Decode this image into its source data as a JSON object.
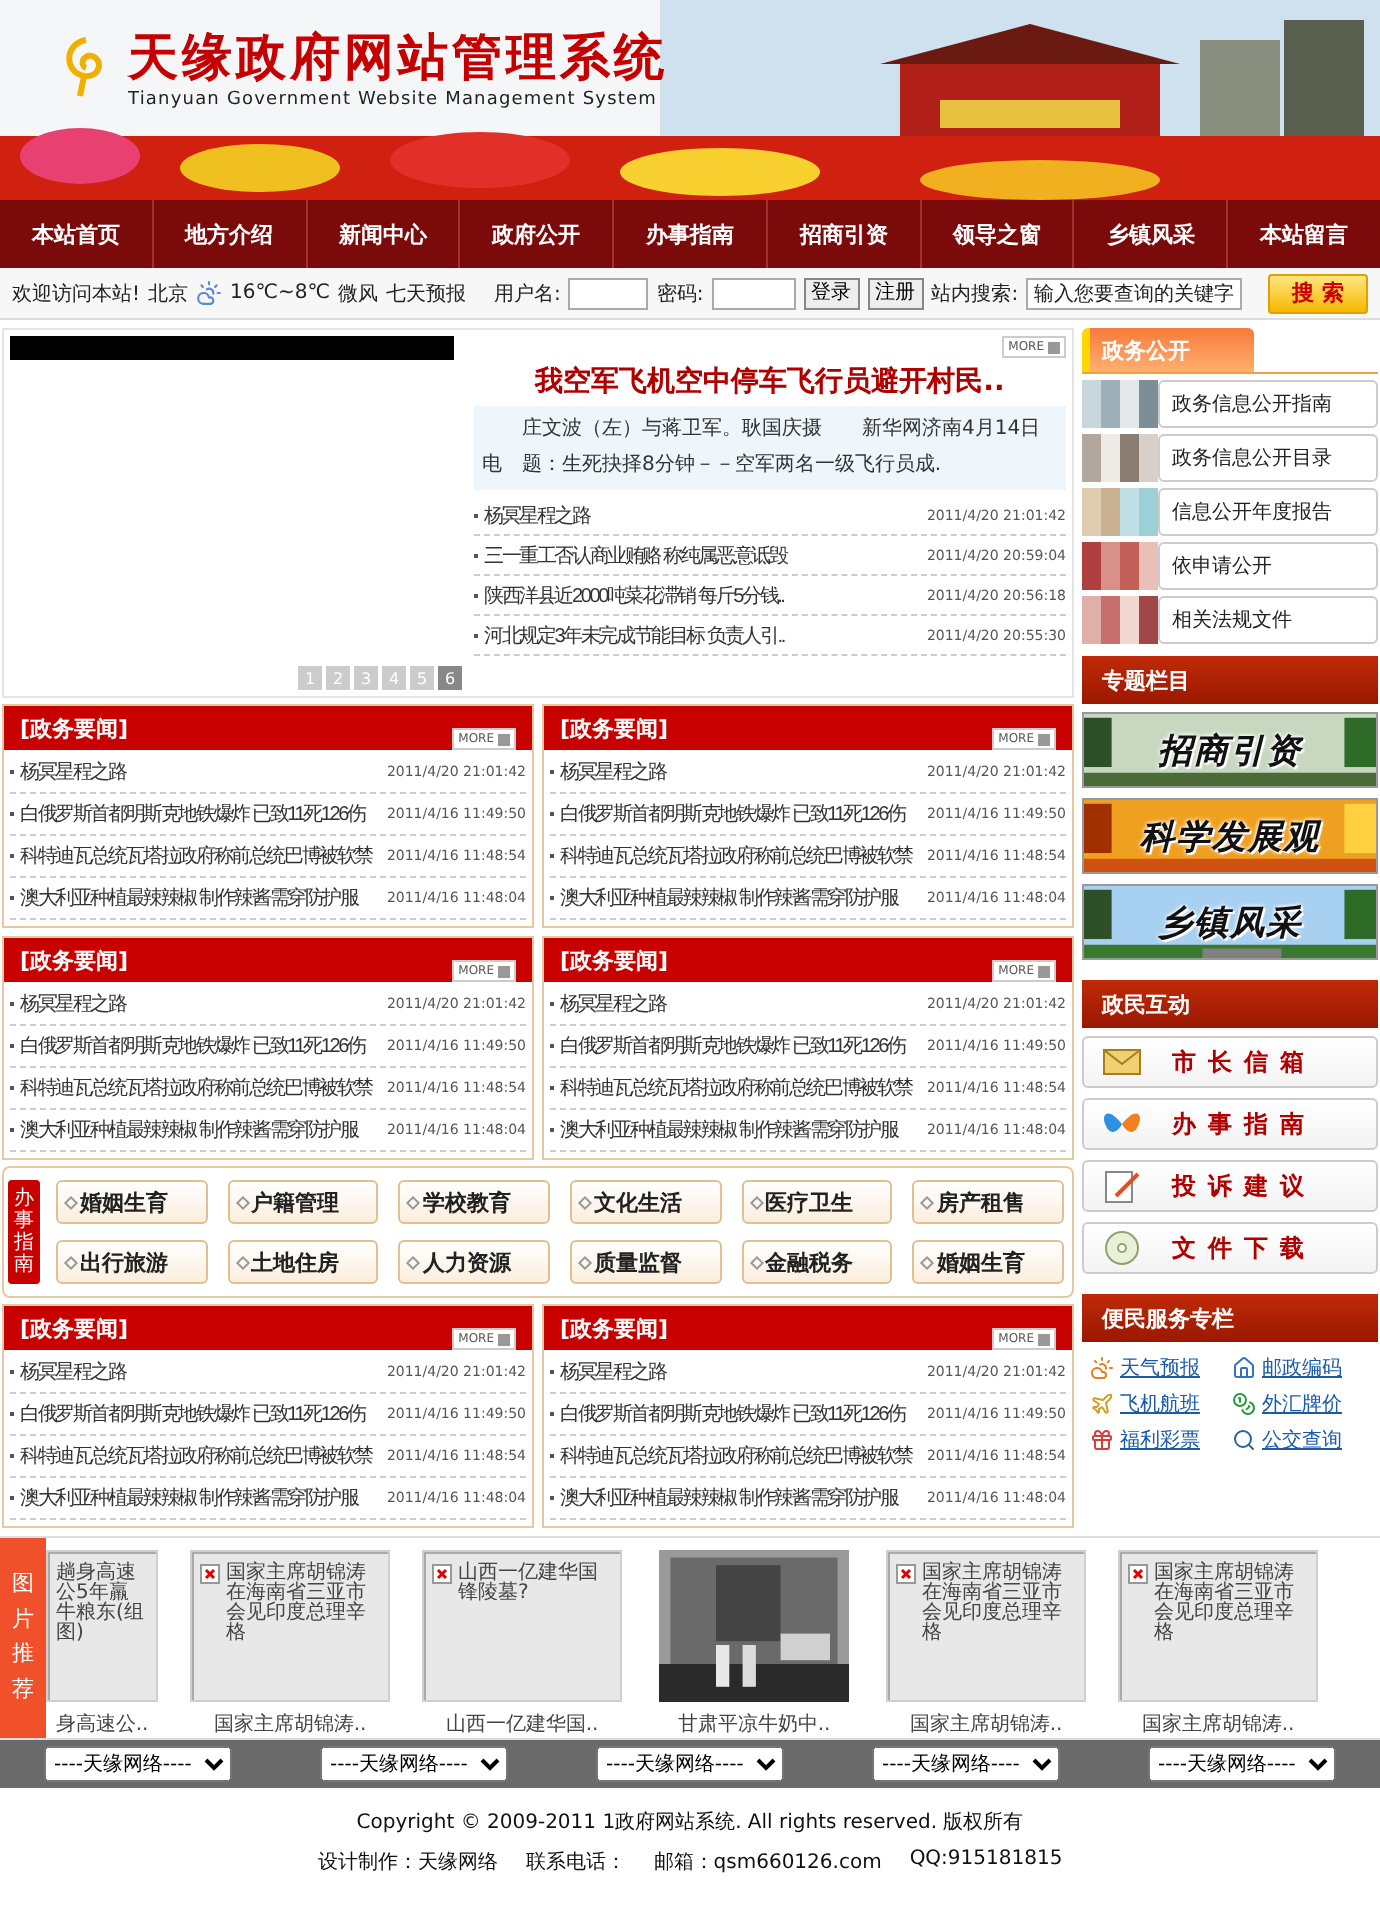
{
  "header": {
    "title": "天缘政府网站管理系统",
    "subtitle": "Tianyuan Government Website Management System"
  },
  "nav": [
    "本站首页",
    "地方介绍",
    "新闻中心",
    "政府公开",
    "办事指南",
    "招商引资",
    "领导之窗",
    "乡镇风采",
    "本站留言"
  ],
  "infobar": {
    "welcome": "欢迎访问本站!",
    "city": "北京",
    "temperature": "16℃~8℃",
    "wind": "微风",
    "forecast": "七天预报",
    "username_label": "用户名:",
    "password_label": "密码:",
    "login": "登录",
    "register": "注册",
    "search_label": "站内搜索:",
    "search_value": "输入您要查询的关键字",
    "search_button": "搜 索"
  },
  "slideshow": {
    "pages": [
      {
        "label": "1",
        "selected": false
      },
      {
        "label": "2",
        "selected": false
      },
      {
        "label": "3",
        "selected": false
      },
      {
        "label": "4",
        "selected": false
      },
      {
        "label": "5",
        "selected": false
      },
      {
        "label": "6",
        "selected": true
      }
    ]
  },
  "headline": {
    "more": "MORE",
    "title": "我空军飞机空中停车飞行员避开村民..",
    "summary": "庄文波（左）与蒋卫军。耿国庆摄　　新华网济南4月14日电　题：生死抉择8分钟－－空军两名一级飞行员成.",
    "items": [
      {
        "title": "杨冥星程之路",
        "time": "2011/4/20 21:01:42"
      },
      {
        "title": "三一重工否认商业贿赂 称纯属恶意诋毁",
        "time": "2011/4/20 20:59:04"
      },
      {
        "title": "陕西洋县近2000吨菜花滞销 每斤5分钱..",
        "time": "2011/4/20 20:56:18"
      },
      {
        "title": "河北规定3年未完成节能目标 负责人引..",
        "time": "2011/4/20 20:55:30"
      }
    ]
  },
  "news_boxes": [
    {
      "title": "[政务要闻]",
      "more": "MORE",
      "items": [
        {
          "title": "杨冥星程之路",
          "time": "2011/4/20 21:01:42"
        },
        {
          "title": "白俄罗斯首都明斯克地铁爆炸 已致11死126伤",
          "time": "2011/4/16 11:49:50"
        },
        {
          "title": "科特迪瓦总统瓦塔拉政府称前总统巴博被软禁",
          "time": "2011/4/16 11:48:54"
        },
        {
          "title": "澳大利亚种植最辣辣椒 制作辣酱需穿防护服",
          "time": "2011/4/16 11:48:04"
        }
      ]
    },
    {
      "title": "[政务要闻]",
      "more": "MORE",
      "items": [
        {
          "title": "杨冥星程之路",
          "time": "2011/4/20 21:01:42"
        },
        {
          "title": "白俄罗斯首都明斯克地铁爆炸 已致11死126伤",
          "time": "2011/4/16 11:49:50"
        },
        {
          "title": "科特迪瓦总统瓦塔拉政府称前总统巴博被软禁",
          "time": "2011/4/16 11:48:54"
        },
        {
          "title": "澳大利亚种植最辣辣椒 制作辣酱需穿防护服",
          "time": "2011/4/16 11:48:04"
        }
      ]
    },
    {
      "title": "[政务要闻]",
      "more": "MORE",
      "items": [
        {
          "title": "杨冥星程之路",
          "time": "2011/4/20 21:01:42"
        },
        {
          "title": "白俄罗斯首都明斯克地铁爆炸 已致11死126伤",
          "time": "2011/4/16 11:49:50"
        },
        {
          "title": "科特迪瓦总统瓦塔拉政府称前总统巴博被软禁",
          "time": "2011/4/16 11:48:54"
        },
        {
          "title": "澳大利亚种植最辣辣椒 制作辣酱需穿防护服",
          "time": "2011/4/16 11:48:04"
        }
      ]
    },
    {
      "title": "[政务要闻]",
      "more": "MORE",
      "items": [
        {
          "title": "杨冥星程之路",
          "time": "2011/4/20 21:01:42"
        },
        {
          "title": "白俄罗斯首都明斯克地铁爆炸 已致11死126伤",
          "time": "2011/4/16 11:49:50"
        },
        {
          "title": "科特迪瓦总统瓦塔拉政府称前总统巴博被软禁",
          "time": "2011/4/16 11:48:54"
        },
        {
          "title": "澳大利亚种植最辣辣椒 制作辣酱需穿防护服",
          "time": "2011/4/16 11:48:04"
        }
      ]
    }
  ],
  "service_guide": {
    "label": "办事指南",
    "buttons": [
      "婚姻生育",
      "户籍管理",
      "学校教育",
      "文化生活",
      "医疗卫生",
      "房产租售",
      "出行旅游",
      "土地住房",
      "人力资源",
      "质量监督",
      "金融税务",
      "婚姻生育"
    ]
  },
  "news_boxes_lower": [
    {
      "title": "[政务要闻]",
      "more": "MORE",
      "items": [
        {
          "title": "杨冥星程之路",
          "time": "2011/4/20 21:01:42"
        },
        {
          "title": "白俄罗斯首都明斯克地铁爆炸 已致11死126伤",
          "time": "2011/4/16 11:49:50"
        },
        {
          "title": "科特迪瓦总统瓦塔拉政府称前总统巴博被软禁",
          "time": "2011/4/16 11:48:54"
        },
        {
          "title": "澳大利亚种植最辣辣椒 制作辣酱需穿防护服",
          "time": "2011/4/16 11:48:04"
        }
      ]
    },
    {
      "title": "[政务要闻]",
      "more": "MORE",
      "items": [
        {
          "title": "杨冥星程之路",
          "time": "2011/4/20 21:01:42"
        },
        {
          "title": "白俄罗斯首都明斯克地铁爆炸 已致11死126伤",
          "time": "2011/4/16 11:49:50"
        },
        {
          "title": "科特迪瓦总统瓦塔拉政府称前总统巴博被软禁",
          "time": "2011/4/16 11:48:54"
        },
        {
          "title": "澳大利亚种植最辣辣椒 制作辣酱需穿防护服",
          "time": "2011/4/16 11:48:04"
        }
      ]
    }
  ],
  "sidebar": {
    "gov_open": {
      "title": "政务公开",
      "items": [
        "政务信息公开指南",
        "政务信息公开目录",
        "信息公开年度报告",
        "依申请公开",
        "相关法规文件"
      ]
    },
    "topics": {
      "title": "专题栏目",
      "banners": [
        "招商引资",
        "科学发展观",
        "乡镇风采"
      ]
    },
    "interaction": {
      "title": "政民互动",
      "buttons": [
        "市长信箱",
        "办事指南",
        "投诉建议",
        "文件下载"
      ]
    },
    "services": {
      "title": "便民服务专栏",
      "links": [
        "天气预报",
        "邮政编码",
        "飞机航班",
        "外汇牌价",
        "福利彩票",
        "公交查询"
      ]
    }
  },
  "pictures": {
    "label": "图片推荐",
    "cards": [
      {
        "kind": "partial",
        "alt": "趟身高速公5年羸牛粮东(组图)",
        "caption": "身高速公.."
      },
      {
        "kind": "broken",
        "alt": "国家主席胡锦涛在海南省三亚市会见印度总理辛格",
        "caption": "国家主席胡锦涛.."
      },
      {
        "kind": "broken",
        "alt": "山西一亿建华国锋陵墓?",
        "caption": "山西一亿建华国.."
      },
      {
        "kind": "picture",
        "caption": "甘肃平凉牛奶中.."
      },
      {
        "kind": "broken",
        "alt": "国家主席胡锦涛在海南省三亚市会见印度总理辛格",
        "caption": "国家主席胡锦涛.."
      },
      {
        "kind": "broken",
        "alt": "国家主席胡锦涛在海南省三亚市会见印度总理辛格",
        "caption": "国家主席胡锦涛.."
      }
    ]
  },
  "link_dropdowns": [
    "----天缘网络----",
    "----天缘网络----",
    "----天缘网络----",
    "----天缘网络----",
    "----天缘网络----"
  ],
  "footer": {
    "copyright": "Copyright © 2009-2011 1政府网站系统. All rights reserved. 版权所有",
    "design": "设计制作：天缘网络",
    "phone": "联系电话：",
    "email": "邮箱：qsm660126.com",
    "qq": "QQ:915181815"
  }
}
